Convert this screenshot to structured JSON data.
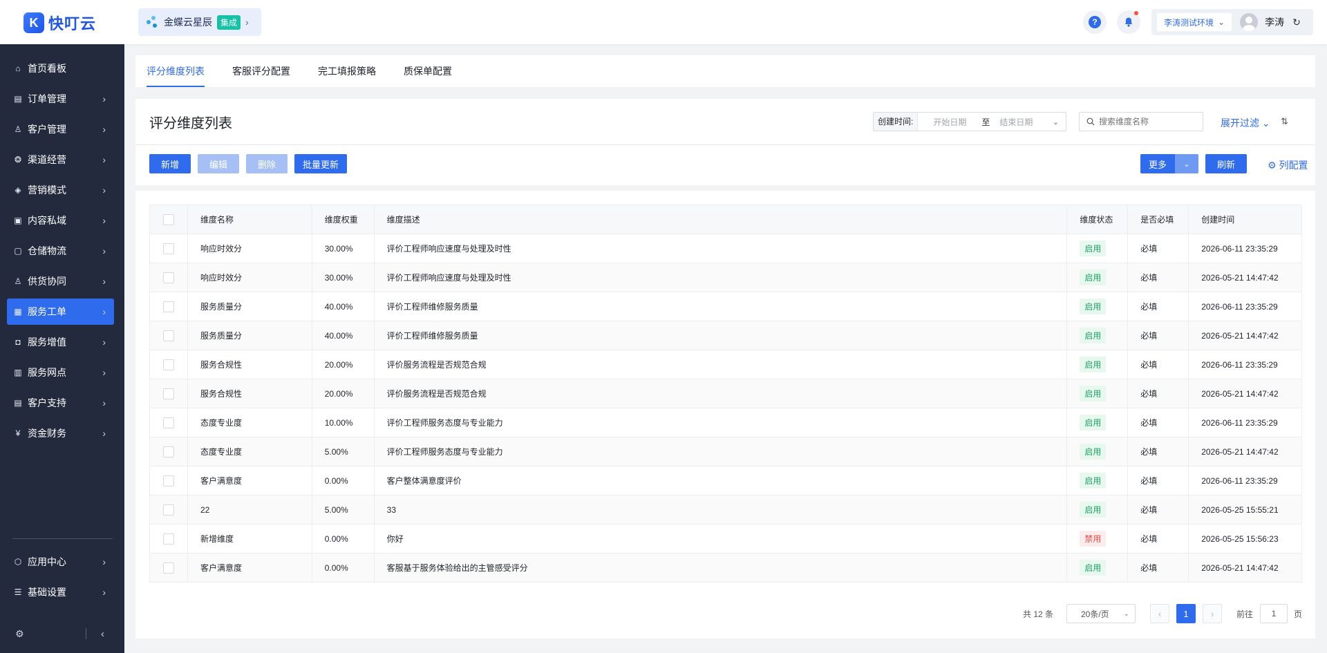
{
  "header": {
    "logo_text": "快叮云",
    "app_name": "金蝶云星辰",
    "app_badge": "集成",
    "help_glyph": "?",
    "environment": "李涛测试环境",
    "user_name": "李涛"
  },
  "sidebar": {
    "items": [
      {
        "label": "首页看板",
        "icon": "home-icon",
        "has_arrow": false
      },
      {
        "label": "订单管理",
        "icon": "clipboard-icon",
        "has_arrow": true
      },
      {
        "label": "客户管理",
        "icon": "user-icon",
        "has_arrow": true
      },
      {
        "label": "渠道经营",
        "icon": "channel-icon",
        "has_arrow": true
      },
      {
        "label": "营销模式",
        "icon": "tag-icon",
        "has_arrow": true
      },
      {
        "label": "内容私域",
        "icon": "image-icon",
        "has_arrow": true
      },
      {
        "label": "仓储物流",
        "icon": "warehouse-icon",
        "has_arrow": true
      },
      {
        "label": "供货协同",
        "icon": "supplier-icon",
        "has_arrow": true
      },
      {
        "label": "服务工单",
        "icon": "workorder-icon",
        "has_arrow": true,
        "active": true
      },
      {
        "label": "服务增值",
        "icon": "bag-icon",
        "has_arrow": true
      },
      {
        "label": "服务网点",
        "icon": "store-icon",
        "has_arrow": true
      },
      {
        "label": "客户支持",
        "icon": "support-icon",
        "has_arrow": true
      },
      {
        "label": "资金财务",
        "icon": "yen-icon",
        "has_arrow": true
      }
    ],
    "bottom_items": [
      {
        "label": "应用中心",
        "icon": "cube-icon"
      },
      {
        "label": "基础设置",
        "icon": "settings-list-icon"
      }
    ]
  },
  "tabs": [
    {
      "label": "评分维度列表",
      "active": true
    },
    {
      "label": "客服评分配置",
      "active": false
    },
    {
      "label": "完工填报策略",
      "active": false
    },
    {
      "label": "质保单配置",
      "active": false
    }
  ],
  "page": {
    "title": "评分维度列表",
    "date_filter_label": "创建时间:",
    "start_placeholder": "开始日期",
    "range_separator": "至",
    "end_placeholder": "结束日期",
    "search_placeholder": "搜索维度名称",
    "expand_filter": "展开过滤"
  },
  "toolbar": {
    "add": "新增",
    "edit": "编辑",
    "delete": "删除",
    "batch_update": "批量更新",
    "more": "更多",
    "refresh": "刷新",
    "column_config": "列配置"
  },
  "table": {
    "columns": [
      "维度名称",
      "维度权重",
      "维度描述",
      "维度状态",
      "是否必填",
      "创建时间"
    ],
    "rows": [
      {
        "name": "响应时效分",
        "weight": "30.00%",
        "desc": "评价工程师响应速度与处理及时性",
        "status": "启用",
        "required": "必填",
        "created": "2026-06-11 23:35:29"
      },
      {
        "name": "响应时效分",
        "weight": "30.00%",
        "desc": "评价工程师响应速度与处理及时性",
        "status": "启用",
        "required": "必填",
        "created": "2026-05-21 14:47:42"
      },
      {
        "name": "服务质量分",
        "weight": "40.00%",
        "desc": "评价工程师维修服务质量",
        "status": "启用",
        "required": "必填",
        "created": "2026-06-11 23:35:29"
      },
      {
        "name": "服务质量分",
        "weight": "40.00%",
        "desc": "评价工程师维修服务质量",
        "status": "启用",
        "required": "必填",
        "created": "2026-05-21 14:47:42"
      },
      {
        "name": "服务合规性",
        "weight": "20.00%",
        "desc": "评价服务流程是否规范合规",
        "status": "启用",
        "required": "必填",
        "created": "2026-06-11 23:35:29"
      },
      {
        "name": "服务合规性",
        "weight": "20.00%",
        "desc": "评价服务流程是否规范合规",
        "status": "启用",
        "required": "必填",
        "created": "2026-05-21 14:47:42"
      },
      {
        "name": "态度专业度",
        "weight": "10.00%",
        "desc": "评价工程师服务态度与专业能力",
        "status": "启用",
        "required": "必填",
        "created": "2026-06-11 23:35:29"
      },
      {
        "name": "态度专业度",
        "weight": "5.00%",
        "desc": "评价工程师服务态度与专业能力",
        "status": "启用",
        "required": "必填",
        "created": "2026-05-21 14:47:42"
      },
      {
        "name": "客户满意度",
        "weight": "0.00%",
        "desc": "客户整体满意度评价",
        "status": "启用",
        "required": "必填",
        "created": "2026-06-11 23:35:29"
      },
      {
        "name": "22",
        "weight": "5.00%",
        "desc": "33",
        "status": "启用",
        "required": "必填",
        "created": "2026-05-25 15:55:21"
      },
      {
        "name": "新增维度",
        "weight": "0.00%",
        "desc": "你好",
        "status": "禁用",
        "required": "必填",
        "created": "2026-05-25 15:56:23"
      },
      {
        "name": "客户满意度",
        "weight": "0.00%",
        "desc": "客服基于服务体验给出的主管感受评分",
        "status": "启用",
        "required": "必填",
        "created": "2026-05-21 14:47:42"
      }
    ]
  },
  "pagination": {
    "total": "共 12 条",
    "page_size": "20条/页",
    "current_page": "1",
    "goto_label": "前往",
    "goto_value": "1",
    "page_unit": "页"
  },
  "colors": {
    "primary": "#2f6bed",
    "sidebar_bg": "#232a3d",
    "status_on": "#21a366",
    "status_off": "#e84c4c"
  }
}
